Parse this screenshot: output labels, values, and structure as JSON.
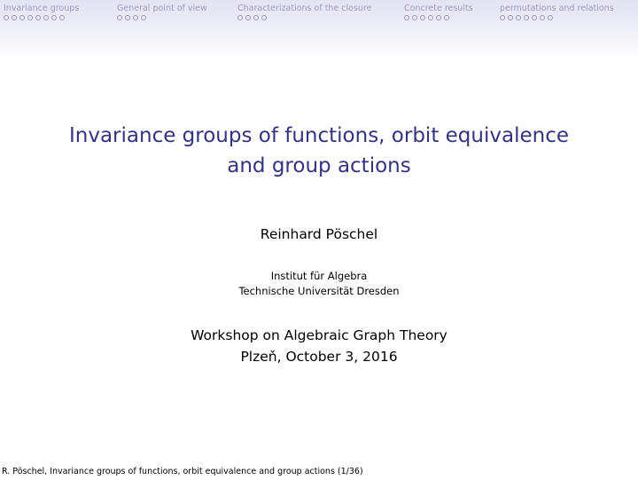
{
  "nav": {
    "sections": [
      {
        "label": "Invariance groups",
        "dots": 8
      },
      {
        "label": "General point of view",
        "dots": 4
      },
      {
        "label": "Characterizations of the closure",
        "dots": 4
      },
      {
        "label": "Concrete results",
        "dots": 6
      },
      {
        "label": "permutations and relations",
        "dots": 7
      }
    ]
  },
  "slide": {
    "title_line1": "Invariance groups of functions, orbit equivalence",
    "title_line2": "and group actions",
    "author": "Reinhard Pöschel",
    "institute_line1": "Institut für Algebra",
    "institute_line2": "Technische Universität Dresden",
    "event_line1": "Workshop on Algebraic Graph Theory",
    "event_line2": "Plzeň, October 3, 2016"
  },
  "footer": {
    "text": "R. Pöschel, Invariance groups of functions, orbit equivalence and group actions (1/36)"
  },
  "colors": {
    "title": "#33337f",
    "nav_text": "#9a9ac2",
    "nav_background": "#e3e3f3"
  }
}
